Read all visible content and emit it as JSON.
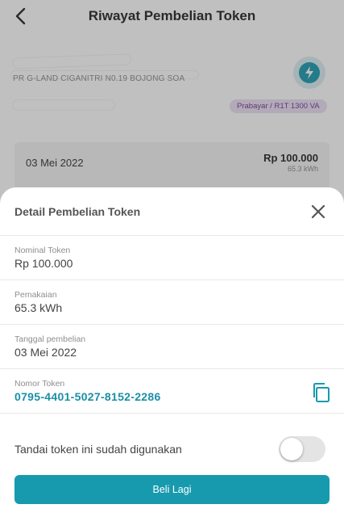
{
  "header": {
    "title": "Riwayat Pembelian Token",
    "back_icon": "back-arrow-icon"
  },
  "customer": {
    "address_partial": "PR G-LAND CIGANITRI N0.19 BOJONG SOA",
    "tariff_badge": "Prabayar / R1T 1300 VA",
    "logo_icon": "pln-logo-icon",
    "badge_color": "#ecdff4"
  },
  "history": {
    "date": "03 Mei 2022",
    "amount": "Rp 100.000",
    "kwh": "65.3 kWh"
  },
  "sheet": {
    "title": "Detail Pembelian Token",
    "close_icon": "close-icon",
    "fields": [
      {
        "label": "Nominal Token",
        "value": "Rp 100.000"
      },
      {
        "label": "Pemakaian",
        "value": "65.3 kWh"
      },
      {
        "label": "Tanggal pembelian",
        "value": "03 Mei 2022"
      },
      {
        "label": "Nomor Token",
        "value": "0795-4401-5027-8152-2286"
      }
    ],
    "copy_icon": "copy-icon",
    "mark_label": "Tandai token ini sudah digunakan",
    "toggle_on": false,
    "buy_again_label": "Beli Lagi",
    "accent_color": "#179aae"
  }
}
